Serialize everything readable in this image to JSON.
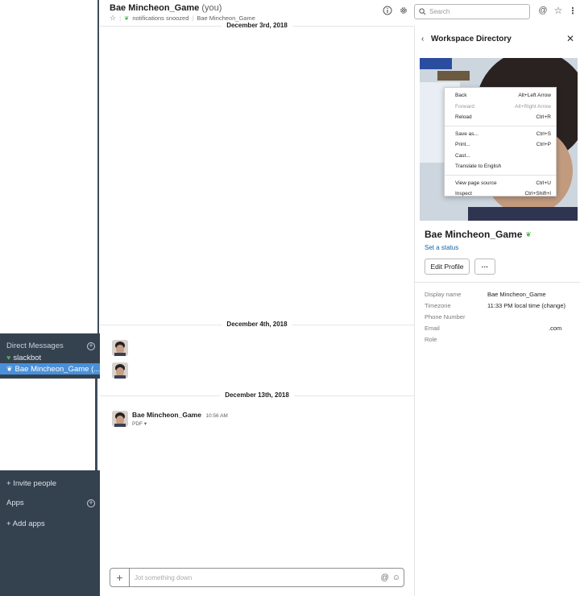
{
  "colors": {
    "sidebar_bg": "#34414f",
    "active": "#4a90d9",
    "link": "#1264a3",
    "presence": "#4caf50"
  },
  "sidebar": {
    "dm_header": "Direct Messages",
    "items": [
      {
        "label": "slackbot",
        "icon": "heart-icon"
      },
      {
        "label": "Bae Mincheon_Game (...",
        "icon": "presence-icon",
        "active": true
      }
    ],
    "invite": "+ Invite people",
    "apps": "Apps",
    "add_apps": "+ Add apps"
  },
  "header": {
    "title": "Bae Mincheon_Game",
    "you": "(you)",
    "notifications": "notifications snoozed",
    "channel_name": "Bae Mincheon_Game",
    "search_placeholder": "Search"
  },
  "messages": {
    "dates": [
      "December 3rd, 2018",
      "December 4th, 2018",
      "December 13th, 2018"
    ],
    "author": "Bae Mincheon_Game",
    "time": "10:56 AM",
    "file_type": "PDF"
  },
  "composer": {
    "placeholder": "Jot something down"
  },
  "panel": {
    "title": "Workspace Directory",
    "name": "Bae Mincheon_Game",
    "set_status": "Set a status",
    "edit_profile": "Edit Profile",
    "more": "···",
    "fields": [
      {
        "label": "Display name",
        "value": "Bae Mincheon_Game"
      },
      {
        "label": "Timezone",
        "value": "11:33 PM local time (change)"
      },
      {
        "label": "Phone Number",
        "value": ""
      },
      {
        "label": "Email",
        "value": ".com"
      },
      {
        "label": "Role",
        "value": ""
      }
    ]
  },
  "context_menu": {
    "items": [
      {
        "label": "Back",
        "shortcut": "Alt+Left Arrow",
        "disabled": false
      },
      {
        "label": "Forward",
        "shortcut": "Alt+Right Arrow",
        "disabled": true
      },
      {
        "label": "Reload",
        "shortcut": "Ctrl+R",
        "disabled": false
      },
      {
        "label": "Save as...",
        "shortcut": "Ctrl+S",
        "disabled": false
      },
      {
        "label": "Print...",
        "shortcut": "Ctrl+P",
        "disabled": false
      },
      {
        "label": "Cast...",
        "shortcut": "",
        "disabled": false
      },
      {
        "label": "Translate to English",
        "shortcut": "",
        "disabled": false
      },
      {
        "label": "View page source",
        "shortcut": "Ctrl+U",
        "disabled": false
      },
      {
        "label": "Inspect",
        "shortcut": "Ctrl+Shift+I",
        "disabled": false
      }
    ]
  }
}
